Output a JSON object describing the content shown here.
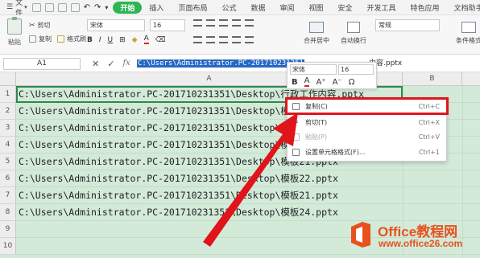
{
  "menubar": {
    "file_label": "文件",
    "tabs": [
      {
        "label": "开始",
        "active": true
      },
      {
        "label": "插入",
        "active": false
      },
      {
        "label": "页面布局",
        "active": false
      },
      {
        "label": "公式",
        "active": false
      },
      {
        "label": "数据",
        "active": false
      },
      {
        "label": "审阅",
        "active": false
      },
      {
        "label": "视图",
        "active": false
      },
      {
        "label": "安全",
        "active": false
      },
      {
        "label": "开发工具",
        "active": false
      },
      {
        "label": "特色应用",
        "active": false
      },
      {
        "label": "文档助手",
        "active": false
      }
    ]
  },
  "ribbon": {
    "paste_label": "粘贴",
    "cut_label": "剪切",
    "copy_label": "复制",
    "format_painter_label": "格式刷",
    "font_name": "宋体",
    "font_size": "16",
    "merge_label": "合并居中",
    "wrap_label": "自动换行",
    "number_format": "常规",
    "conditional_label": "条件格式"
  },
  "formula_bar": {
    "name_box": "A1",
    "fx": "fx",
    "content_selected": "C:\\Users\\Administrator.PC-201710231351",
    "content_rest": "内容.pptx"
  },
  "grid": {
    "columns": [
      "A",
      "B"
    ],
    "rows": [
      {
        "num": "1",
        "text": "C:\\Users\\Administrator.PC-201710231351\\Desktop\\行政工作内容.pptx"
      },
      {
        "num": "2",
        "text": "C:\\Users\\Administrator.PC-201710231351\\Desktop\\模板11.pptx"
      },
      {
        "num": "3",
        "text": "C:\\Users\\Administrator.PC-201710231351\\Desktop\\模板12.pptx"
      },
      {
        "num": "4",
        "text": "C:\\Users\\Administrator.PC-201710231351\\Desktop\\模板13.pptx"
      },
      {
        "num": "5",
        "text": "C:\\Users\\Administrator.PC-201710231351\\Desktop\\模板21.pptx"
      },
      {
        "num": "6",
        "text": "C:\\Users\\Administrator.PC-201710231351\\Desktop\\模板22.pptx"
      },
      {
        "num": "7",
        "text": "C:\\Users\\Administrator.PC-201710231351\\Desktop\\模板21.pptx"
      },
      {
        "num": "8",
        "text": "C:\\Users\\Administrator.PC-201710231351\\Desktop\\模板24.pptx"
      },
      {
        "num": "9",
        "text": ""
      },
      {
        "num": "10",
        "text": ""
      }
    ]
  },
  "mini_toolbar": {
    "font_name": "宋体",
    "font_size": "16",
    "bold": "B",
    "color_a": "A",
    "grow": "A⁺",
    "shrink": "A⁻",
    "special": "Ω"
  },
  "context_menu": {
    "items": [
      {
        "label": "复制(C)",
        "shortcut": "Ctrl+C",
        "enabled": true,
        "icon": "copy-icon"
      },
      {
        "label": "剪切(T)",
        "shortcut": "Ctrl+X",
        "enabled": true,
        "icon": "cut-icon"
      },
      {
        "label": "粘贴(P)",
        "shortcut": "Ctrl+V",
        "enabled": false,
        "icon": "paste-icon"
      },
      {
        "label": "设置单元格格式(F)...",
        "shortcut": "Ctrl+1",
        "enabled": true,
        "icon": "format-cells-icon"
      }
    ]
  },
  "watermark": {
    "name": "Office教程网",
    "url": "www.office26.com"
  },
  "colors": {
    "accent": "#2fb455",
    "highlight": "#e0141b",
    "selection": "#2468c4",
    "grid_bg": "#d3ead9"
  }
}
